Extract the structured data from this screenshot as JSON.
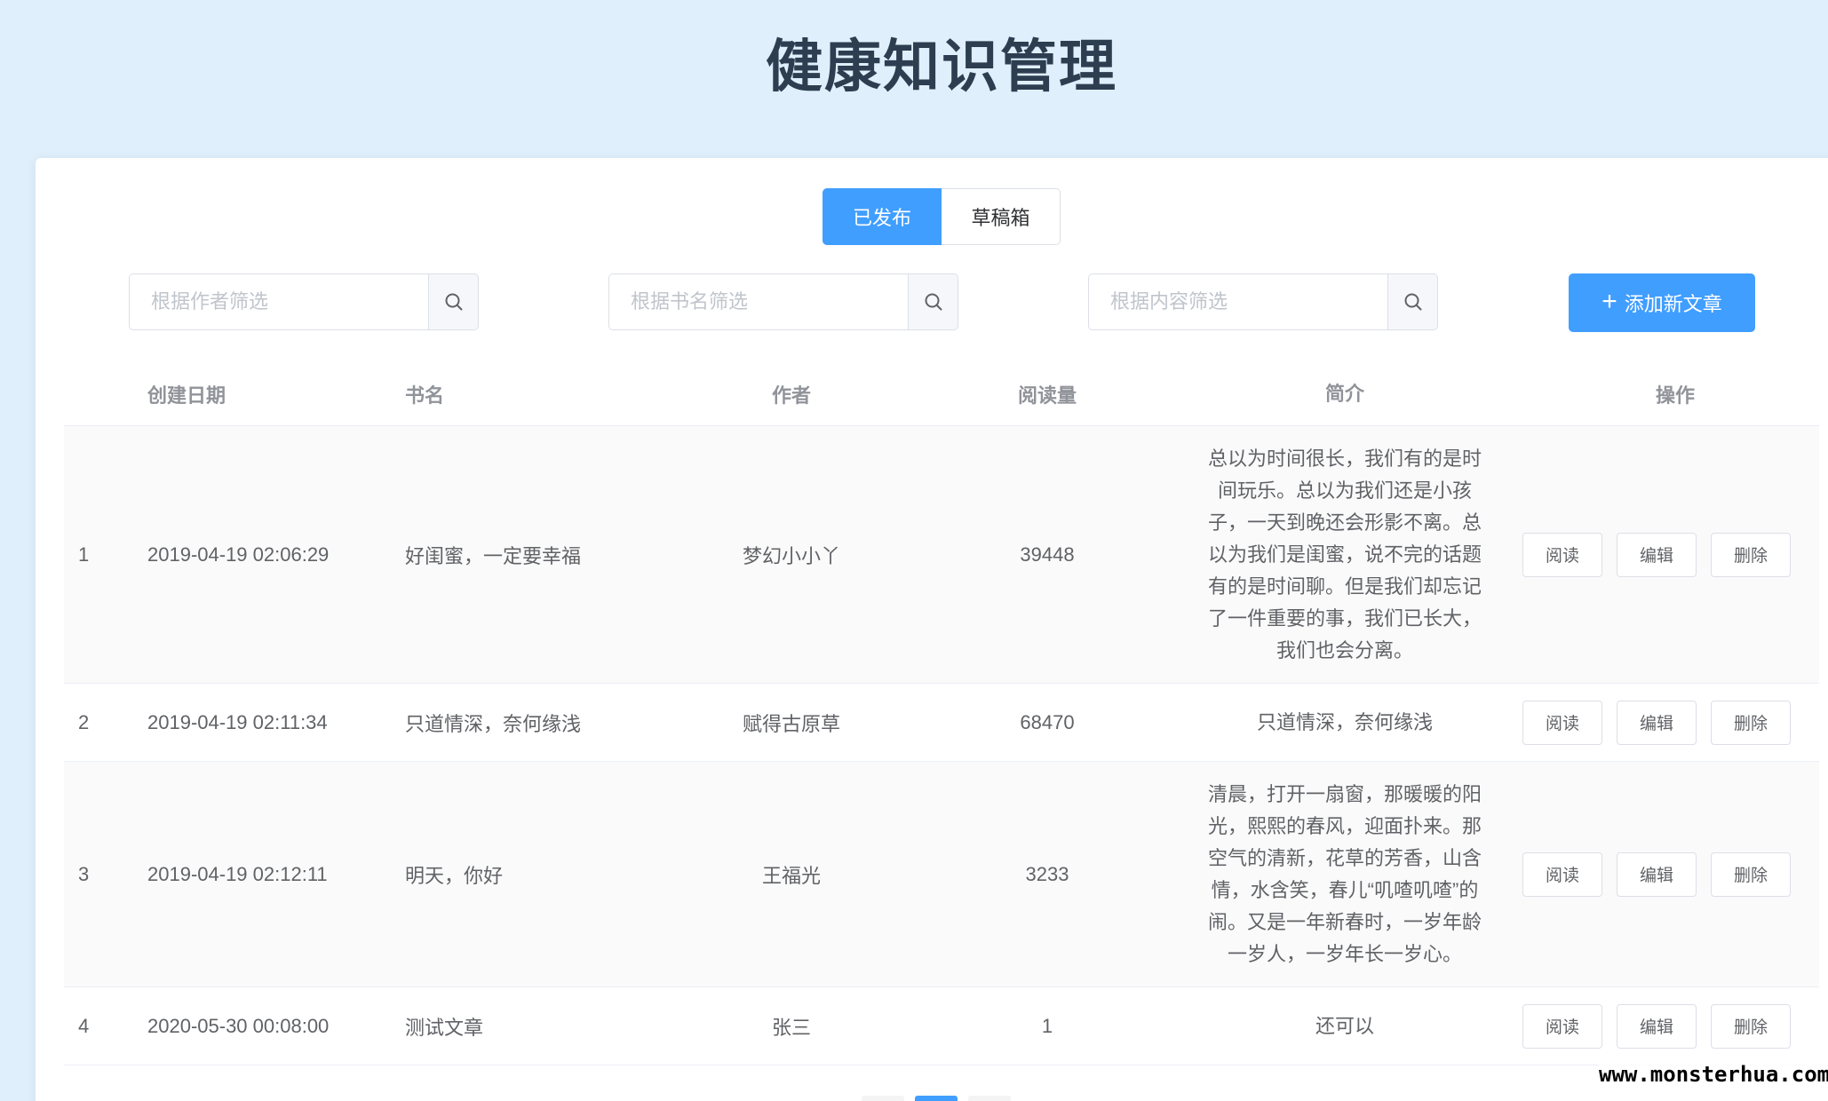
{
  "page": {
    "title": "健康知识管理",
    "accent_color": "#409eff"
  },
  "tabs": [
    {
      "label": "已发布",
      "active": true
    },
    {
      "label": "草稿箱",
      "active": false
    }
  ],
  "filters": {
    "author": {
      "placeholder": "根据作者筛选",
      "value": ""
    },
    "book": {
      "placeholder": "根据书名筛选",
      "value": ""
    },
    "content": {
      "placeholder": "根据内容筛选",
      "value": ""
    },
    "search_icon": "search-icon"
  },
  "add_button": {
    "label": "添加新文章",
    "icon": "plus-icon"
  },
  "table": {
    "columns": [
      "创建日期",
      "书名",
      "作者",
      "阅读量",
      "简介",
      "操作"
    ],
    "rows": [
      {
        "index": "1",
        "date": "2019-04-19 02:06:29",
        "title": "好闺蜜，一定要幸福",
        "author": "梦幻小小丫",
        "reads": "39448",
        "intro": "总以为时间很长，我们有的是时间玩乐。总以为我们还是小孩子，一天到晚还会形影不离。总以为我们是闺蜜，说不完的话题有的是时间聊。但是我们却忘记了一件重要的事，我们已长大，我们也会分离。"
      },
      {
        "index": "2",
        "date": "2019-04-19 02:11:34",
        "title": "只道情深，奈何缘浅",
        "author": "赋得古原草",
        "reads": "68470",
        "intro": "只道情深，奈何缘浅"
      },
      {
        "index": "3",
        "date": "2019-04-19 02:12:11",
        "title": "明天，你好",
        "author": "王福光",
        "reads": "3233",
        "intro": "清晨，打开一扇窗，那暖暖的阳光，熙熙的春风，迎面扑来。那空气的清新，花草的芳香，山含情，水含笑，春儿“叽喳叽喳”的闹。又是一年新春时，一岁年龄一岁人，一岁年长一岁心。"
      },
      {
        "index": "4",
        "date": "2020-05-30 00:08:00",
        "title": "测试文章",
        "author": "张三",
        "reads": "1",
        "intro": "还可以"
      }
    ],
    "actions": {
      "read": "阅读",
      "edit": "编辑",
      "delete": "删除"
    }
  },
  "watermark": "www.monsterhua.com"
}
